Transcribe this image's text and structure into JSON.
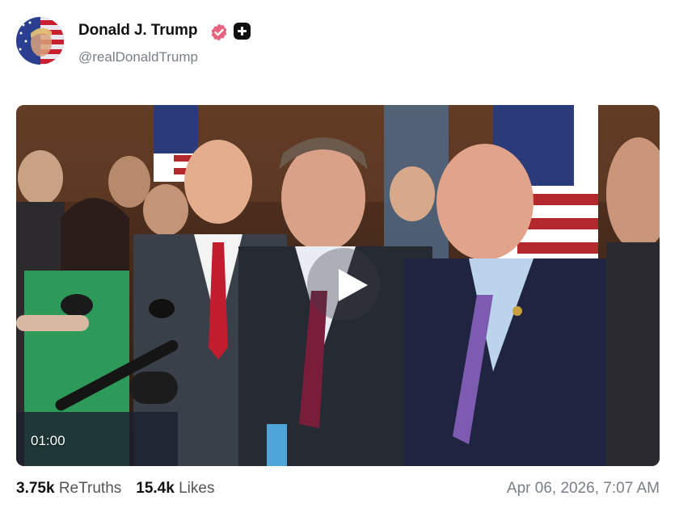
{
  "author": {
    "display_name": "Donald J. Trump",
    "handle": "@realDonaldTrump",
    "verified_icon": "verified-badge-icon",
    "verified_color": "#e5637e",
    "plus_icon": "plus-badge-icon"
  },
  "media": {
    "type": "video",
    "duration": "01:00",
    "play_icon": "play-icon"
  },
  "stats": {
    "retruths_count": "3.75k",
    "retruths_label": "ReTruths",
    "likes_count": "15.4k",
    "likes_label": "Likes"
  },
  "timestamp": "Apr 06, 2026, 7:07 AM"
}
